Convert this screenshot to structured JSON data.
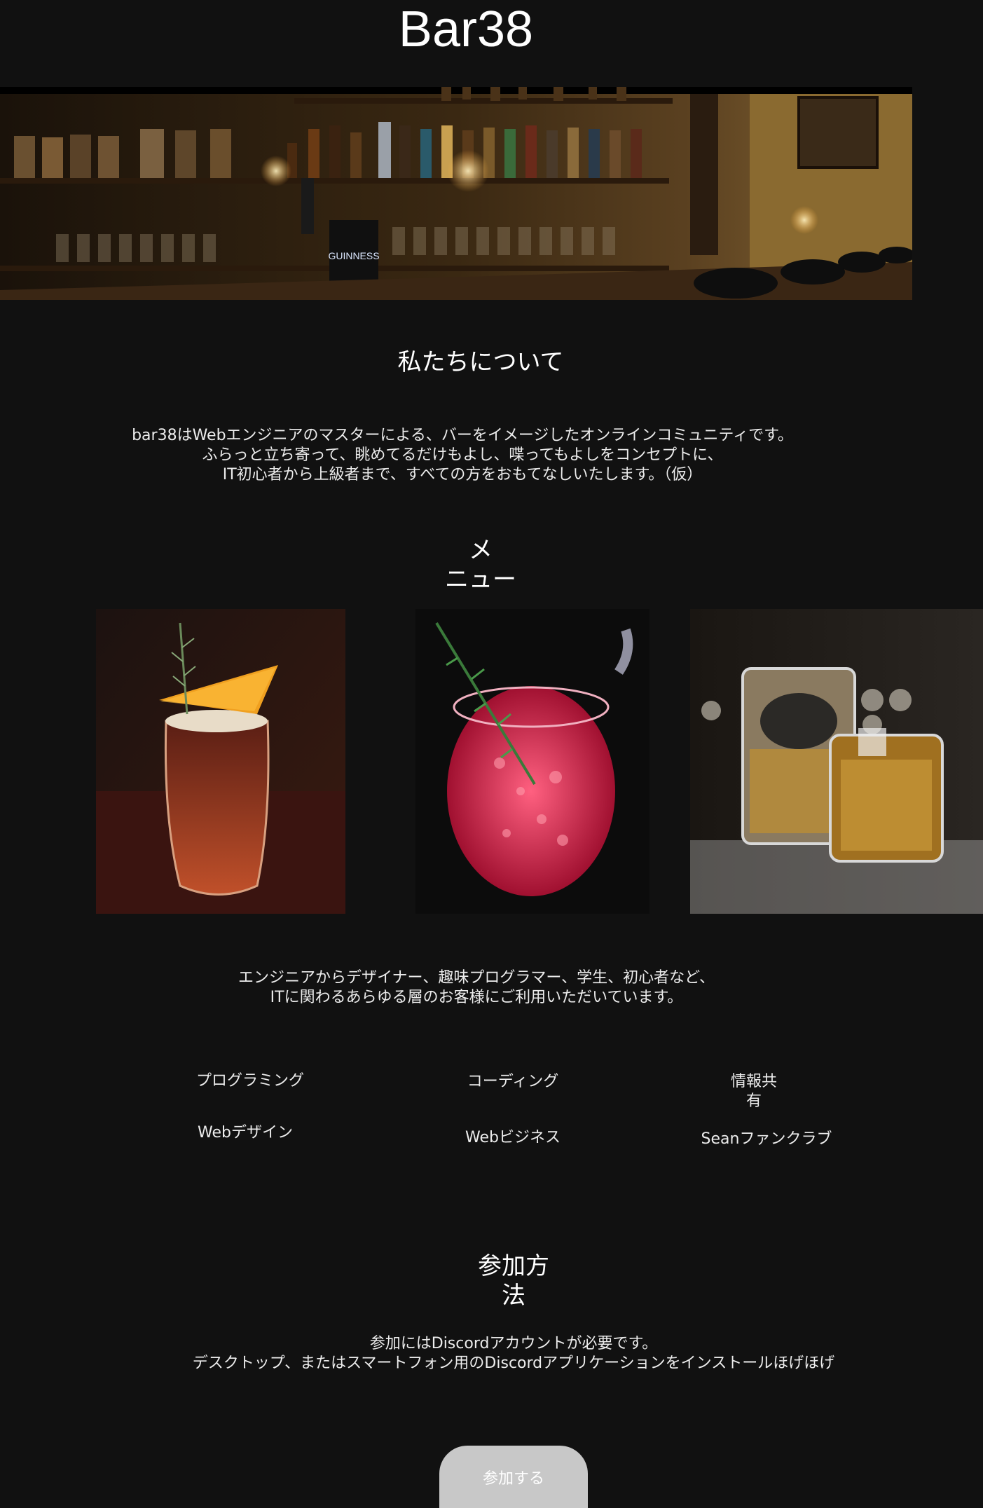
{
  "header": {
    "site_title": "Bar38"
  },
  "about": {
    "title": "私たちについて",
    "lines": [
      "bar38はWebエンジニアのマスターによる、バーをイメージしたオンラインコミュニティです。",
      "ふらっと立ち寄って、眺めてるだけもよし、喋ってもよしをコンセプトに、",
      "IT初心者から上級者まで、すべての方をおもてなしいたします。（仮）"
    ]
  },
  "menu": {
    "title_lines": [
      "メ",
      "ニュー"
    ],
    "audience_lines": [
      "エンジニアからデザイナー、趣味プログラマー、学生、初心者など、",
      "ITに関わるあらゆる層のお客様にご利用いただいています。"
    ],
    "tags": [
      {
        "label": "プログラミング"
      },
      {
        "label": "コーディング"
      },
      {
        "label_lines": [
          "情報共",
          "有"
        ]
      },
      {
        "label": "Webデザイン"
      },
      {
        "label": "Webビジネス"
      },
      {
        "label": "Seanファンクラブ"
      }
    ]
  },
  "join": {
    "title_lines": [
      "参加方",
      "法"
    ],
    "lines": [
      "参加にはDiscordアカウントが必要です。",
      "デスクトップ、またはスマートフォン用のDiscordアプリケーションをインストールほげほげ"
    ],
    "button_label": "参加する"
  },
  "colors": {
    "background": "#111111",
    "text": "#ececec",
    "button": "#c8c8c8"
  }
}
